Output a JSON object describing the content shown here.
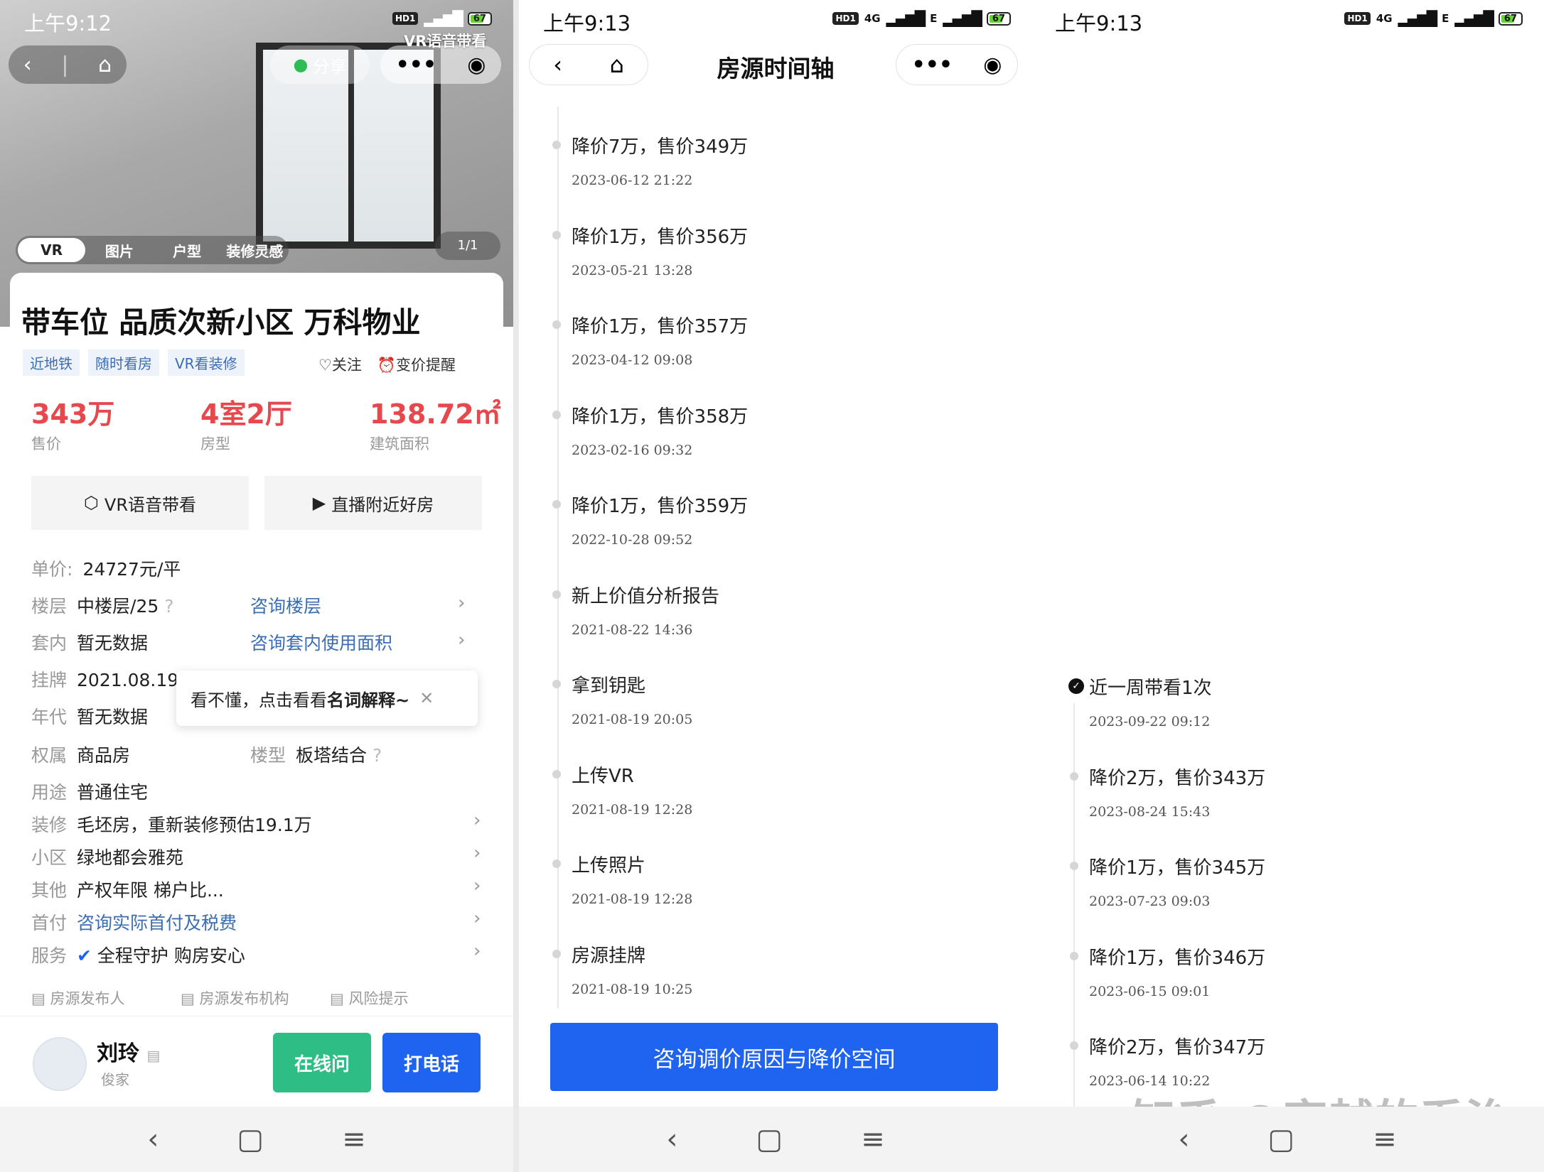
{
  "status": {
    "p1_time": "上午9:12",
    "p2_time": "上午9:13",
    "p3_time": "上午9:13",
    "hd": "HD1",
    "net": "4G",
    "net2": "E",
    "battery": "67"
  },
  "p1": {
    "share": "分享",
    "vr_badge": "VR语音带看",
    "media_tabs": [
      "VR",
      "图片",
      "户型",
      "装修灵感"
    ],
    "counter": "1/1",
    "title": "带车位 品质次新小区 万科物业",
    "tags": [
      "近地铁",
      "随时看房",
      "VR看装修"
    ],
    "follow": "关注",
    "price_alert": "变价提醒",
    "kpis": [
      {
        "value": "343万",
        "label": "售价"
      },
      {
        "value": "4室2厅",
        "label": "房型"
      },
      {
        "value": "138.72㎡",
        "label": "建筑面积"
      }
    ],
    "btn_vr": "VR语音带看",
    "btn_live": "直播附近好房",
    "unit_price": {
      "k": "单价:",
      "v": "24727元/平"
    },
    "floor": {
      "k": "楼层",
      "v": "中楼层/25",
      "link": "咨询楼层"
    },
    "inner": {
      "k": "套内",
      "v": "暂无数据",
      "link": "咨询套内使用面积"
    },
    "listing": {
      "k": "挂牌",
      "v": "2021.08.19"
    },
    "year": {
      "k": "年代",
      "v": "暂无数据"
    },
    "tooltip_a": "看不懂，点击看看",
    "tooltip_b": "名词解释~",
    "ownership": {
      "k": "权属",
      "v": "商品房",
      "k2": "楼型",
      "v2": "板塔结合"
    },
    "usage": {
      "k": "用途",
      "v": "普通住宅"
    },
    "decor": {
      "k": "装修",
      "v": "毛坯房，重新装修预估19.1万"
    },
    "community": {
      "k": "小区",
      "v": "绿地都会雅苑"
    },
    "other": {
      "k": "其他",
      "v": "产权年限 梯户比..."
    },
    "down": {
      "k": "首付",
      "v": "咨询实际首付及税费"
    },
    "service": {
      "k": "服务",
      "v": "全程守护 购房安心"
    },
    "foot": [
      "房源发布人",
      "房源发布机构",
      "风险提示"
    ],
    "agent_name": "刘玲",
    "agent_sub": "俊家",
    "btn_online": "在线问",
    "btn_call": "打电话"
  },
  "p2": {
    "title": "房源时间轴",
    "events": [
      {
        "title": "降价7万，售价349万",
        "date": "2023-06-12 21:22"
      },
      {
        "title": "降价1万，售价356万",
        "date": "2023-05-21 13:28"
      },
      {
        "title": "降价1万，售价357万",
        "date": "2023-04-12 09:08"
      },
      {
        "title": "降价1万，售价358万",
        "date": "2023-02-16 09:32"
      },
      {
        "title": "降价1万，售价359万",
        "date": "2022-10-28 09:52"
      },
      {
        "title": "新上价值分析报告",
        "date": "2021-08-22 14:36"
      },
      {
        "title": "拿到钥匙",
        "date": "2021-08-19 20:05"
      },
      {
        "title": "上传VR",
        "date": "2021-08-19 12:28"
      },
      {
        "title": "上传照片",
        "date": "2021-08-19 12:28"
      },
      {
        "title": "房源挂牌",
        "date": "2021-08-19 10:25"
      }
    ],
    "consult": "咨询调价原因与降价空间"
  },
  "p3": {
    "events": [
      {
        "title": "近一周带看1次",
        "date": "2023-09-22 09:12"
      },
      {
        "title": "降价2万，售价343万",
        "date": "2023-08-24 15:43"
      },
      {
        "title": "降价1万，售价345万",
        "date": "2023-07-23 09:03"
      },
      {
        "title": "降价1万，售价346万",
        "date": "2023-06-15 09:01"
      },
      {
        "title": "降价2万，售价347万",
        "date": "2023-06-14 10:22"
      }
    ],
    "watermark": "知乎 @穿越的乔治"
  },
  "colors": {
    "red": "#e5484d",
    "blue": "#1f64f0",
    "green": "#2ebd85",
    "link": "#3c6db0"
  }
}
